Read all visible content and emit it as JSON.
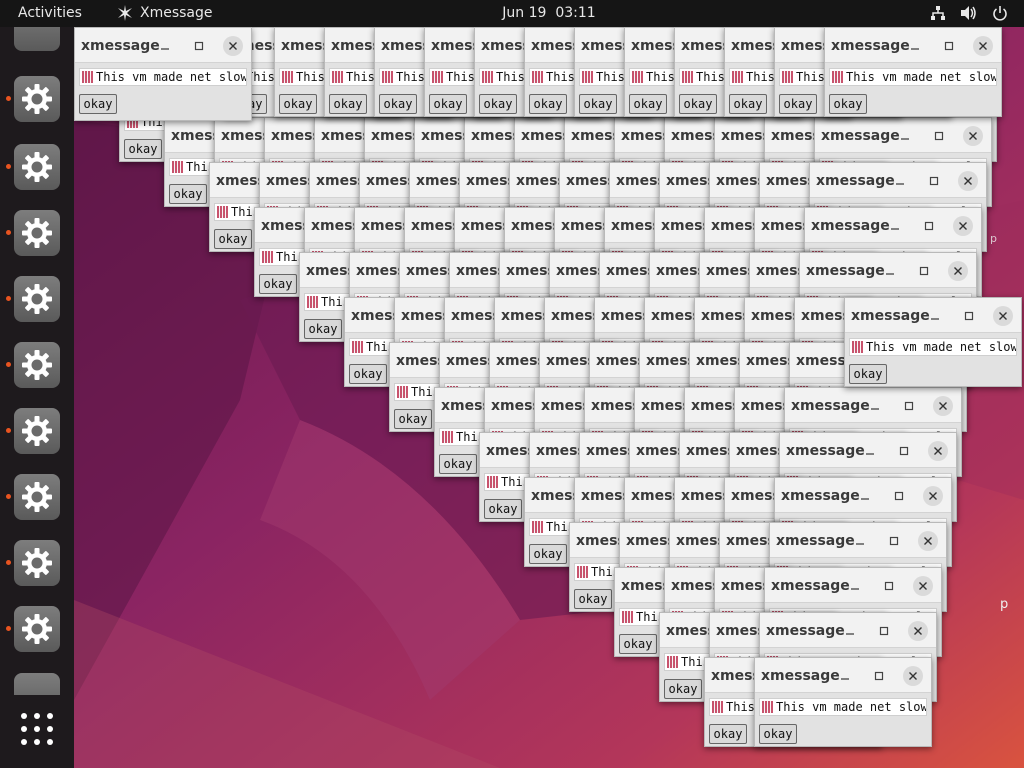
{
  "topbar": {
    "activities": "Activities",
    "app_name": "Xmessage",
    "date": "Jun 19",
    "time": "03:11"
  },
  "icons": {
    "app_menu": "xmessage-app-icon",
    "network": "network-icon",
    "volume": "volume-icon",
    "power": "power-icon",
    "dock_app": "settings-gear-icon",
    "apps_grid": "show-applications-icon"
  },
  "colors": {
    "topbar_bg": "#151515",
    "dock_bg": "#1e1a1d",
    "running_dot": "#e95420",
    "wallpaper_a": "#7a1d5d",
    "wallpaper_b": "#d24b3a"
  },
  "xmessage": {
    "title": "xmessage",
    "message": "This vm made net slow",
    "button": "okay"
  },
  "desktop": {
    "ghost_p": "p"
  }
}
